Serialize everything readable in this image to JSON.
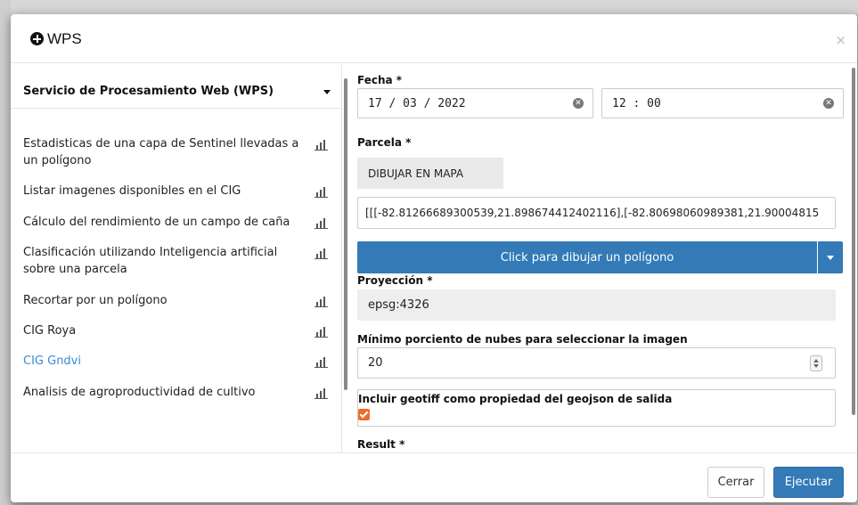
{
  "modal": {
    "title": "WPS",
    "close_glyph": "×"
  },
  "left": {
    "service_label": "Servicio de Procesamiento Web (WPS)",
    "processes": [
      {
        "label": "Estadisticas de una capa de Sentinel llevadas a un polígono"
      },
      {
        "label": "Listar imagenes disponibles en el CIG"
      },
      {
        "label": "Cálculo del rendimiento de un campo de caña"
      },
      {
        "label": "Clasificación utilizando Inteligencia artificial sobre una parcela"
      },
      {
        "label": "Recortar por un polígono"
      },
      {
        "label": "CIG Roya"
      },
      {
        "label": "CIG Gndvi"
      },
      {
        "label": "Analisis de agroproductividad de cultivo"
      }
    ],
    "icon": "bar-chart-icon"
  },
  "form": {
    "fecha_label": "Fecha *",
    "date_value": "17 / 03 / 2022",
    "time_value": "12 : 00",
    "parcela_label": "Parcela *",
    "draw_map_label": "DIBUJAR EN MAPA",
    "coords_value": "[[[-82.81266689300539,21.898674412402116],[-82.80698060989381,21.90004815",
    "draw_polygon_label": "Click para dibujar un polígono",
    "proyeccion_label": "Proyección *",
    "proyeccion_value": "epsg:4326",
    "nubes_label": "Mínimo porciento de nubes para seleccionar la imagen",
    "nubes_value": "20",
    "geotiff_label": "Incluir geotiff como propiedad del geojson de salida",
    "geotiff_checked": true,
    "result_label": "Result *"
  },
  "footer": {
    "cancel_label": "Cerrar",
    "run_label": "Ejecutar"
  },
  "colors": {
    "primary": "#337ab7",
    "checkbox": "#ef6c2a",
    "link": "#3a8ad2"
  }
}
